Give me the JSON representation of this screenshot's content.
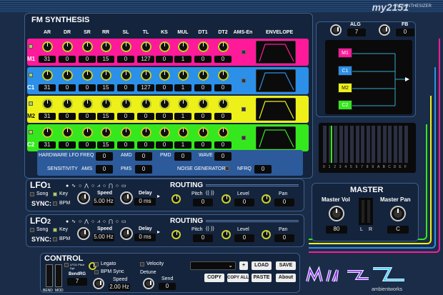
{
  "app": {
    "title": "my2151",
    "subtitle": "FM SYNTHESIZER"
  },
  "fm": {
    "title": "FM SYNTHESIS",
    "columns": [
      "AR",
      "DR",
      "SR",
      "RR",
      "SL",
      "TL",
      "KS",
      "MUL",
      "DT1",
      "DT2",
      "AMS-En",
      "ENVELOPE"
    ],
    "ops": [
      {
        "label": "M1",
        "color": "#ff1a9a",
        "values": [
          "31",
          "0",
          "0",
          "15",
          "0",
          "127",
          "0",
          "1",
          "0",
          "0"
        ]
      },
      {
        "label": "C1",
        "color": "#2c8fe8",
        "values": [
          "31",
          "0",
          "0",
          "15",
          "0",
          "127",
          "0",
          "1",
          "0",
          "0"
        ]
      },
      {
        "label": "M2",
        "color": "#eef01a",
        "values": [
          "31",
          "0",
          "0",
          "15",
          "0",
          "0",
          "0",
          "1",
          "0",
          "0"
        ]
      },
      {
        "label": "C2",
        "color": "#35e81e",
        "values": [
          "31",
          "0",
          "0",
          "15",
          "0",
          "0",
          "0",
          "1",
          "0",
          "0"
        ]
      }
    ]
  },
  "alg": {
    "alg_label": "ALG",
    "alg_value": "7",
    "fb_label": "FB",
    "fb_value": "0",
    "boxes": [
      "M1",
      "C1",
      "M2",
      "C2"
    ]
  },
  "scope": {
    "ticks": [
      "0",
      "1",
      "2",
      "3",
      "4",
      "5",
      "6",
      "7",
      "8",
      "9",
      "A",
      "B",
      "C",
      "D",
      "E",
      "F"
    ]
  },
  "hw": {
    "hw_lfo": "HARDWARE LFO",
    "freq": "FREQ",
    "freq_v": "0",
    "amd": "AMD",
    "amd_v": "0",
    "pmd": "PMD",
    "pmd_v": "0",
    "wave": "WAVE",
    "wave_v": "0",
    "sens": "SENSITIVITY",
    "ams": "AMS",
    "ams_v": "0",
    "pms": "PMS",
    "pms_v": "0",
    "noise": "NOISE GENERATOR",
    "nfrq": "NFRQ",
    "nfrq_v": "0"
  },
  "lfo1": {
    "name": "LFO",
    "num": "1",
    "song": "Song",
    "key": "Key",
    "sync": "SYNC:",
    "bpm": "BPM",
    "speed": "Speed",
    "speed_v": "5.00 Hz",
    "delay": "Delay",
    "delay_v": "0 ms",
    "routing": "ROUTING",
    "pitch": "Pitch",
    "pitch_v": "0",
    "level": "Level",
    "level_v": "0",
    "pan": "Pan",
    "pan_v": "0"
  },
  "lfo2": {
    "name": "LFO",
    "num": "2",
    "song": "Song",
    "key": "Key",
    "sync": "SYNC:",
    "bpm": "BPM",
    "speed": "Speed",
    "speed_v": "5.00 Hz",
    "delay": "Delay",
    "delay_v": "0 ms",
    "routing": "ROUTING",
    "pitch": "Pitch",
    "pitch_v": "0",
    "level": "Level",
    "level_v": "0",
    "pan": "Pan",
    "pan_v": "0"
  },
  "master": {
    "title": "MASTER",
    "vol": "Master Vol",
    "vol_v": "80",
    "pan": "Master Pan",
    "pan_v": "C",
    "l": "L",
    "r": "R"
  },
  "control": {
    "title": "CONTROL",
    "lfo1_pitch": "LFO1 Pitch Dpt",
    "bendrg": "BendRG",
    "bendrg_v": "7",
    "bend": "BEND",
    "mod": "MOD",
    "legato": "Legato",
    "bpmsync": "BPM Sync",
    "speed": "Speed",
    "speed_v": "2.00 Hz",
    "velocity": "Velocity",
    "detune": "Detune",
    "send": "Send",
    "send_v": "0",
    "load": "LOAD",
    "save": "SAVE",
    "copy": "COPY",
    "copy_all": "COPY ALL",
    "paste": "PASTE",
    "about": "About",
    "plus": "+",
    "preset": ""
  },
  "logo": {
    "brand": "ambientworks"
  }
}
